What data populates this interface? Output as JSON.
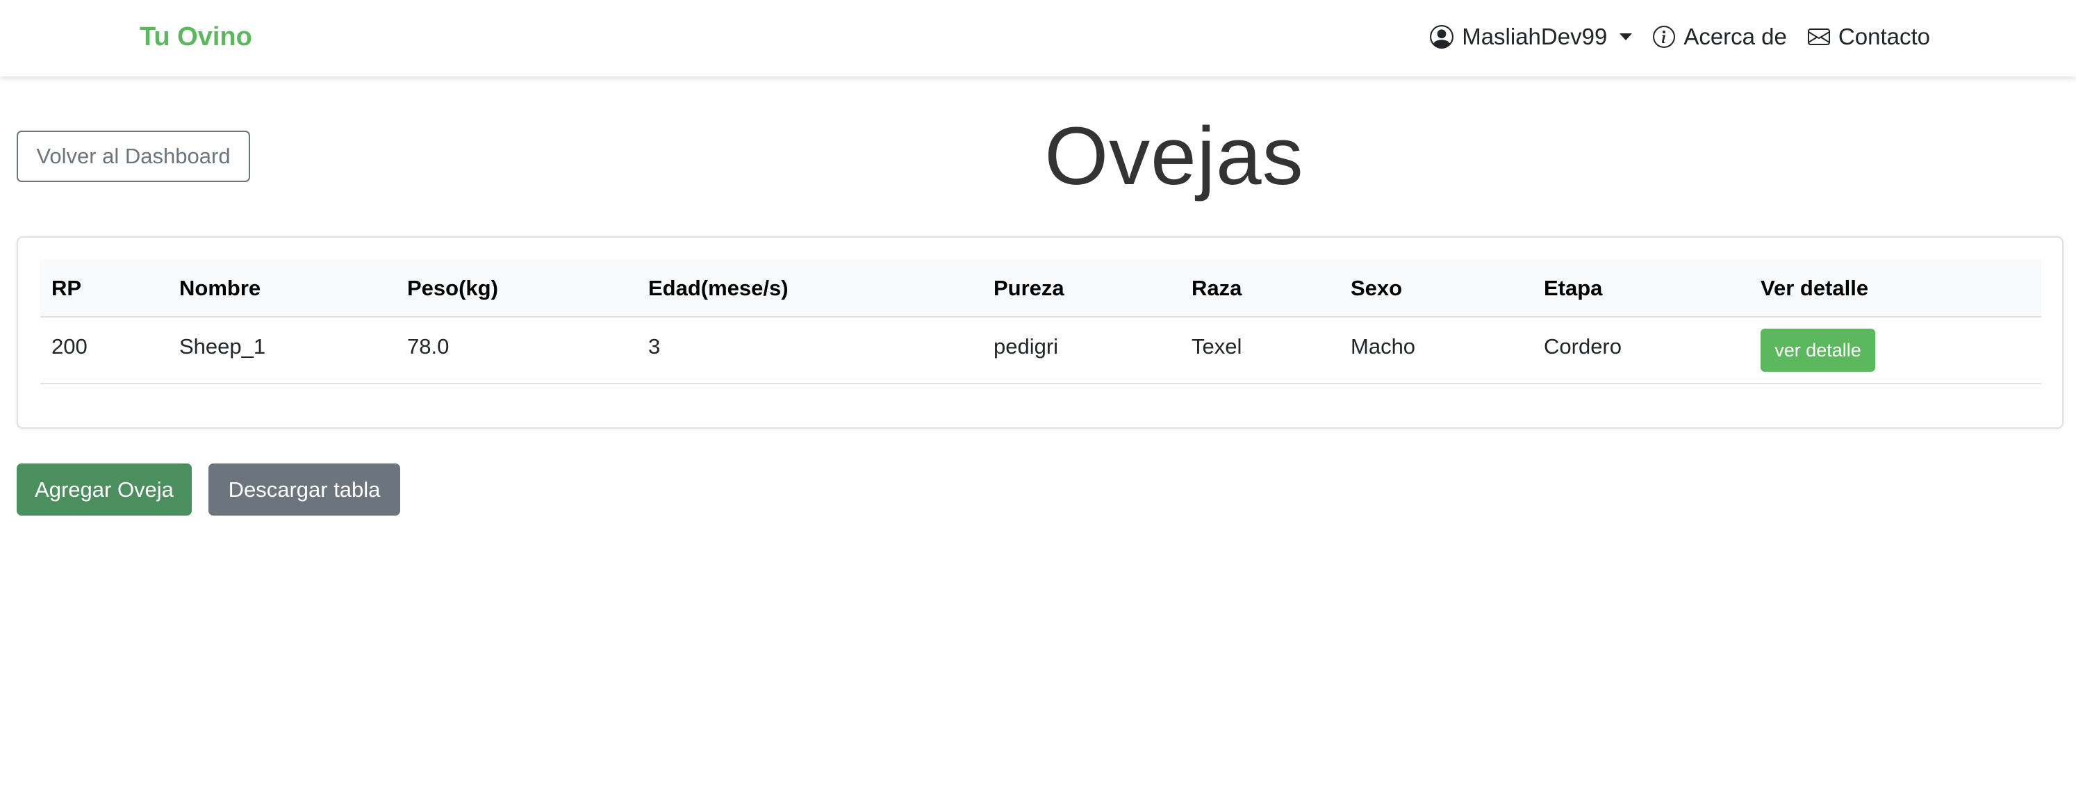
{
  "navbar": {
    "brand": "Tu Ovino",
    "brand_color": "#5cb85c",
    "user": {
      "label": "MasliahDev99",
      "icon": "person-circle-icon"
    },
    "about": {
      "label": "Acerca de",
      "icon": "info-circle-icon"
    },
    "contact": {
      "label": "Contacto",
      "icon": "envelope-icon"
    }
  },
  "header": {
    "back_button": "Volver al Dashboard",
    "title": "Ovejas"
  },
  "table": {
    "columns": [
      "RP",
      "Nombre",
      "Peso(kg)",
      "Edad(mese/s)",
      "Pureza",
      "Raza",
      "Sexo",
      "Etapa",
      "Ver detalle"
    ],
    "rows": [
      {
        "rp": "200",
        "nombre": "Sheep_1",
        "peso": "78.0",
        "edad": "3",
        "pureza": "pedigri",
        "raza": "Texel",
        "sexo": "Macho",
        "etapa": "Cordero",
        "detail_button": "ver detalle"
      }
    ]
  },
  "actions": {
    "add_button": "Agregar Oveja",
    "download_button": "Descargar tabla"
  },
  "colors": {
    "success": "#5cb85c",
    "add": "#4a8f5d",
    "secondary": "#6c757d"
  }
}
